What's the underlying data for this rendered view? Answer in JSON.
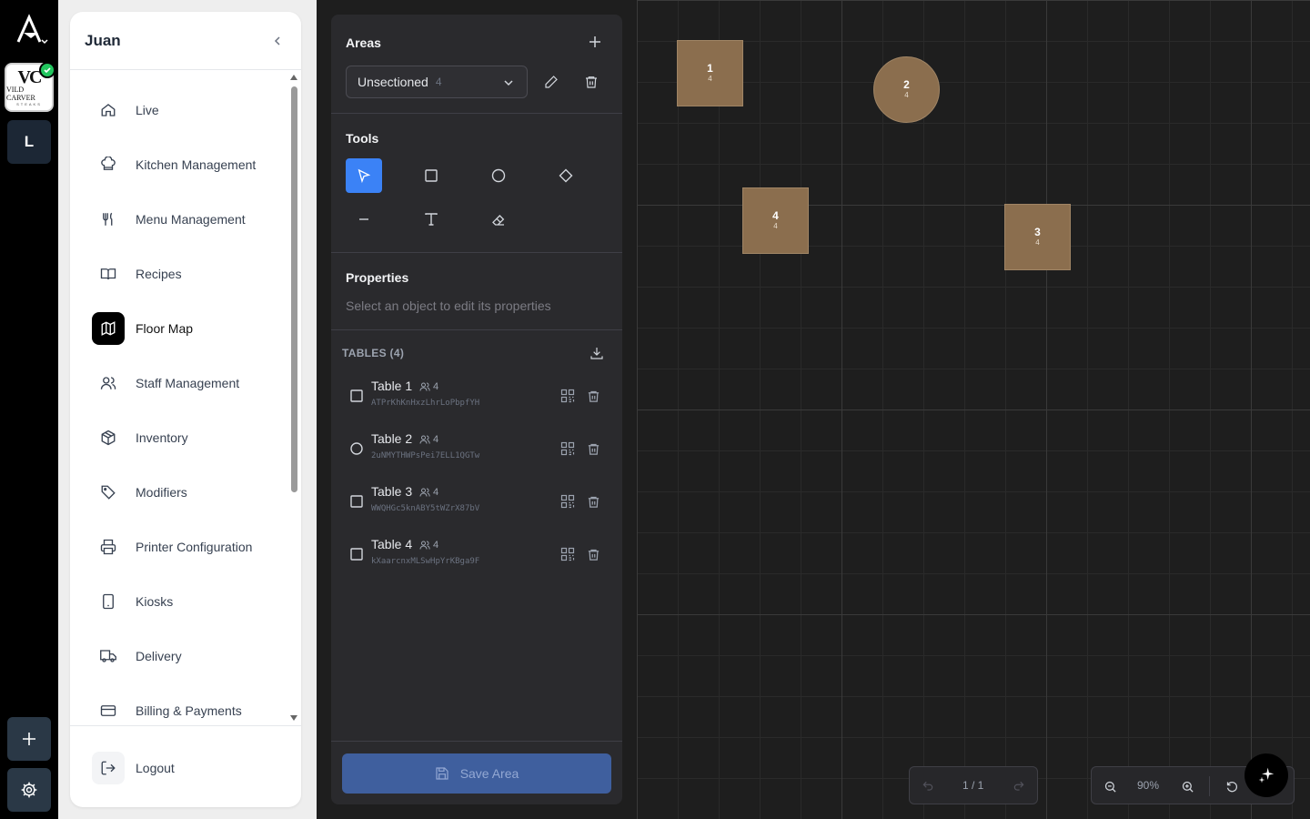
{
  "rail": {
    "brand_line1": "VC",
    "brand_line2": "VILD CARVER",
    "brand_line3": "STEAKS",
    "workspace_initial": "L"
  },
  "sidebar": {
    "user_name": "Juan",
    "items": [
      {
        "label": "Live",
        "icon": "home-icon"
      },
      {
        "label": "Kitchen Management",
        "icon": "chef-hat-icon"
      },
      {
        "label": "Menu Management",
        "icon": "utensils-icon"
      },
      {
        "label": "Recipes",
        "icon": "book-icon"
      },
      {
        "label": "Floor Map",
        "icon": "map-icon",
        "active": true
      },
      {
        "label": "Staff Management",
        "icon": "users-icon"
      },
      {
        "label": "Inventory",
        "icon": "package-icon"
      },
      {
        "label": "Modifiers",
        "icon": "tag-icon"
      },
      {
        "label": "Printer Configuration",
        "icon": "printer-icon"
      },
      {
        "label": "Kiosks",
        "icon": "tablet-icon"
      },
      {
        "label": "Delivery",
        "icon": "truck-icon"
      },
      {
        "label": "Billing & Payments",
        "icon": "credit-card-icon"
      }
    ],
    "logout_label": "Logout"
  },
  "editor": {
    "areas_title": "Areas",
    "area_selected": "Unsectioned",
    "area_count": "4",
    "tools_title": "Tools",
    "properties_title": "Properties",
    "properties_hint": "Select an object to edit its properties",
    "tables_title": "TABLES (4)",
    "tables": [
      {
        "name": "Table 1",
        "capacity": "4",
        "code": "ATPrKhKnHxzLhrLoPbpfYH",
        "shape": "square"
      },
      {
        "name": "Table 2",
        "capacity": "4",
        "code": "2uNMYTHWPsPei7ELL1QGTw",
        "shape": "circle"
      },
      {
        "name": "Table 3",
        "capacity": "4",
        "code": "WWQHGc5knABY5tWZrX87bV",
        "shape": "square"
      },
      {
        "name": "Table 4",
        "capacity": "4",
        "code": "kXaarcnxMLSwHpYrKBga9F",
        "shape": "square"
      }
    ],
    "save_label": "Save Area"
  },
  "canvas": {
    "tables": [
      {
        "number": "1",
        "seats": "4",
        "shape": "square"
      },
      {
        "number": "2",
        "seats": "4",
        "shape": "circle"
      },
      {
        "number": "4",
        "seats": "4",
        "shape": "square"
      },
      {
        "number": "3",
        "seats": "4",
        "shape": "square"
      }
    ],
    "page_indicator": "1 / 1",
    "zoom_level": "90%",
    "table_color": "#8b6e4e"
  },
  "colors": {
    "accent": "#3b82f6",
    "save_button": "#3f5f9e",
    "success": "#22c55e"
  }
}
